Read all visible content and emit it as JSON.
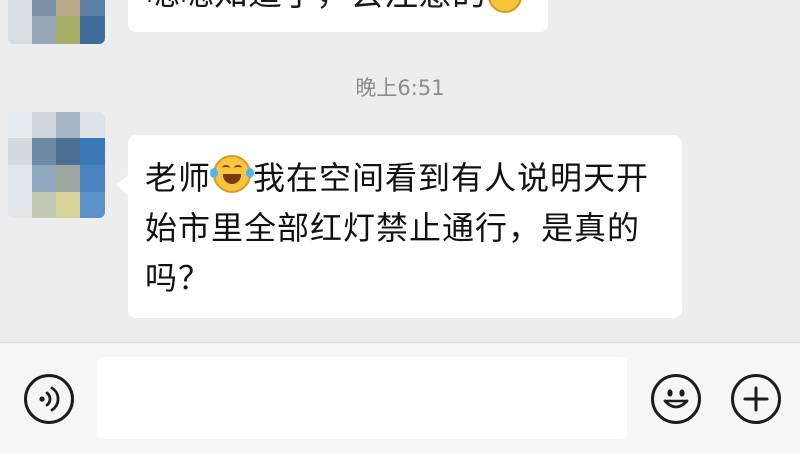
{
  "chat": {
    "previous_message": "嗯嗯知道了，会注意的",
    "timestamp": "晚上6:51",
    "message_part1": "老师",
    "message_part2": "我在空间看到有人说明天开始市里全部红灯禁止通行，是真的吗？"
  },
  "input_bar": {
    "text_value": "",
    "icons": [
      "voice-icon",
      "emoji-icon",
      "plus-icon"
    ]
  },
  "colors": {
    "chat_background": "#ededed",
    "bubble": "#ffffff",
    "timestamp": "#8c8c8c",
    "input_bar": "#f6f6f6"
  }
}
